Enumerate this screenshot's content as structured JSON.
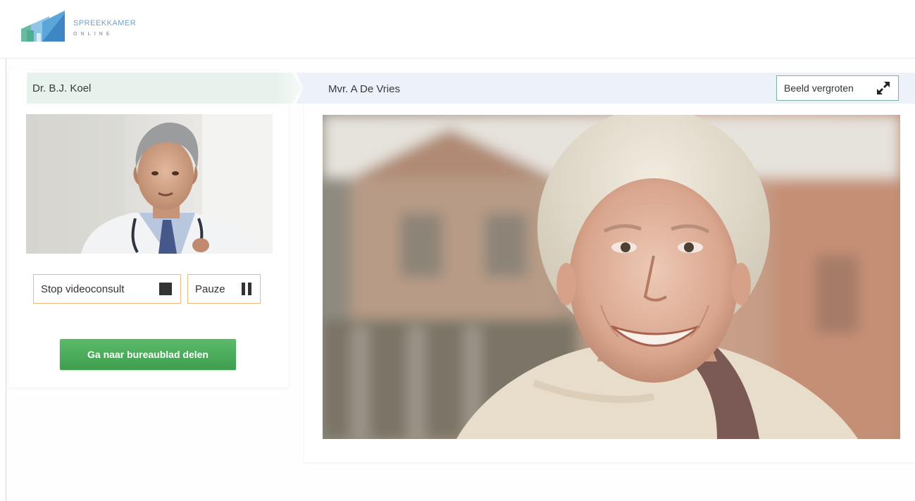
{
  "app": {
    "logo": {
      "line1": "SPREEKKAMER",
      "line2": "ONLINE",
      "icon": "logo-mark"
    }
  },
  "left": {
    "title": "Dr. B.J. Koel",
    "stop_label": "Stop videoconsult",
    "stop_icon": "stop-square-icon",
    "pause_label": "Pauze",
    "pause_icon": "pause-icon",
    "share_label": "Ga naar bureaublad delen"
  },
  "right": {
    "title": "Mvr. A De Vries",
    "enlarge_label": "Beeld vergroten",
    "enlarge_icon": "expand-arrows-icon"
  },
  "colors": {
    "accent_green": "#4caf5c",
    "button_border_orange": "#f0b77f",
    "left_title_bg": "#e8f2ec",
    "right_title_bg": "#ecf1fa"
  }
}
